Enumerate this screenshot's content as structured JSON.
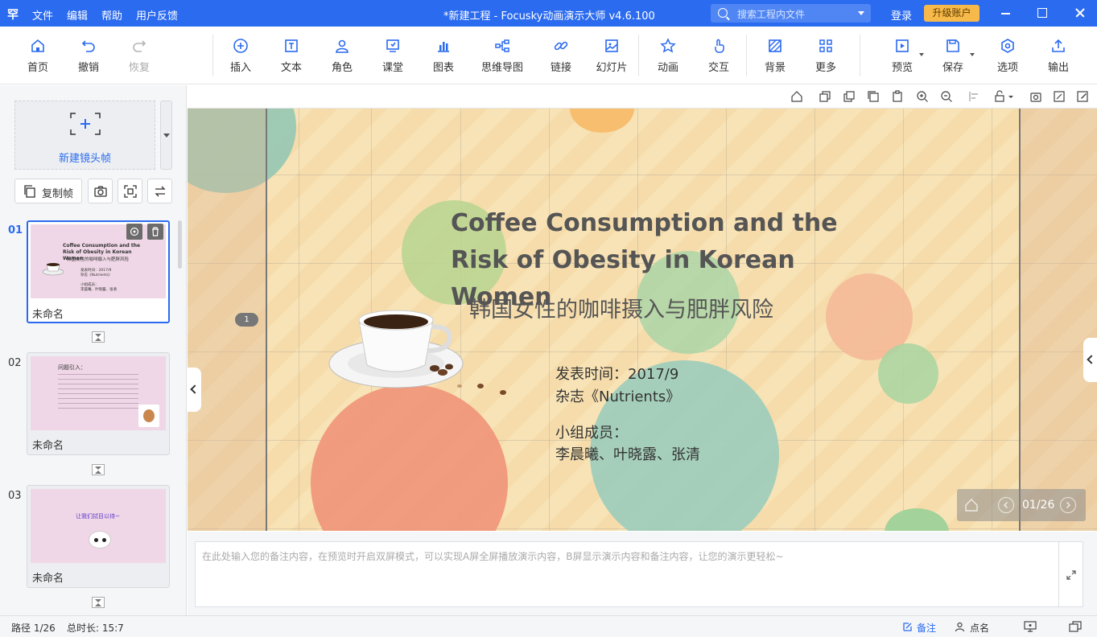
{
  "titlebar": {
    "logo": "罕",
    "menu": [
      "文件",
      "编辑",
      "帮助",
      "用户反馈"
    ],
    "window_title": "*新建工程 - Focusky动画演示大师  v4.6.100",
    "search_placeholder": "搜索工程内文件",
    "login": "登录",
    "upgrade": "升级账户"
  },
  "toolbar": {
    "home": "首页",
    "undo": "撤销",
    "redo": "恢复",
    "insert": "插入",
    "text": "文本",
    "role": "角色",
    "classroom": "课堂",
    "chart": "图表",
    "mindmap": "思维导图",
    "link": "链接",
    "slides": "幻灯片",
    "animation": "动画",
    "interaction": "交互",
    "background": "背景",
    "more": "更多",
    "preview": "预览",
    "save": "保存",
    "options": "选项",
    "export": "输出",
    "accent": "#2b6bf0"
  },
  "left_panel": {
    "new_frame": "新建镜头帧",
    "copy_frame": "复制帧",
    "slides": [
      {
        "num": "01",
        "name": "未命名",
        "thumb_title": "Coffee Consumption and the Risk of Obesity in Korean Women",
        "thumb_sub": "韩国女性的咖啡摄入与肥胖风险",
        "thumb_info": "发表时间：2017/9\n杂志《Nutrients》\n\n小组成员：\n李晨曦、叶晓露、张清"
      },
      {
        "num": "02",
        "name": "未命名",
        "thumb_title": "问题引入："
      },
      {
        "num": "03",
        "name": "未命名",
        "thumb_title": "让我们拭目以待~"
      }
    ]
  },
  "slide": {
    "title": "Coffee Consumption and the Risk of Obesity in Korean Women",
    "subtitle": "韩国女性的咖啡摄入与肥胖风险",
    "pub_time": "发表时间：2017/9",
    "journal": "杂志《Nutrients》",
    "group_label": "小组成员：",
    "members": "李晨曦、叶晓露、张清",
    "page_marker": "1"
  },
  "pager": {
    "text": "01/26"
  },
  "notes": {
    "placeholder": "在此处输入您的备注内容，在预览时开启双屏模式，可以实现A屏全屏播放演示内容，B屏显示演示内容和备注内容，让您的演示更轻松~"
  },
  "statusbar": {
    "path": "路径 1/26",
    "duration": "总时长: 15:7",
    "notes": "备注",
    "rollcall": "点名"
  }
}
